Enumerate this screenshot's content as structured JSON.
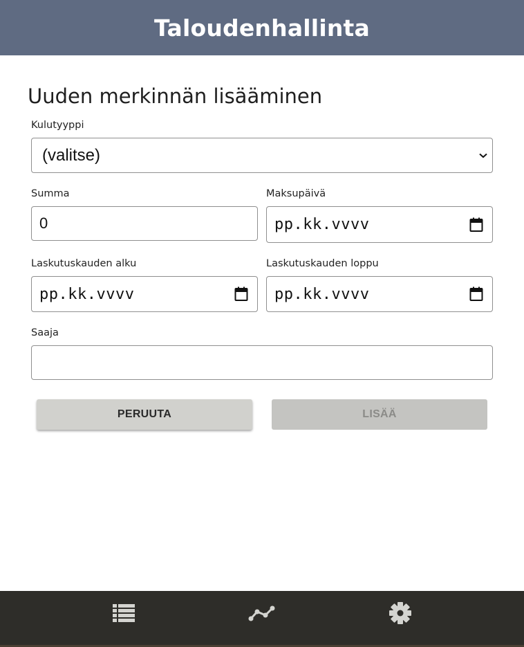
{
  "header": {
    "title": "Taloudenhallinta"
  },
  "form": {
    "title": "Uuden merkinnän lisääminen",
    "expense_type": {
      "label": "Kulutyyppi",
      "selected": "(valitse)"
    },
    "amount": {
      "label": "Summa",
      "value": "0"
    },
    "payment_date": {
      "label": "Maksupäivä",
      "placeholder": "pp.kk.vvvv"
    },
    "billing_start": {
      "label": "Laskutuskauden alku",
      "placeholder": "pp.kk.vvvv"
    },
    "billing_end": {
      "label": "Laskutuskauden loppu",
      "placeholder": "pp.kk.vvvv"
    },
    "recipient": {
      "label": "Saaja",
      "value": ""
    },
    "cancel_label": "PERUUTA",
    "add_label": "LISÄÄ",
    "add_enabled": false
  },
  "bottom_nav": {
    "items": [
      {
        "icon": "list-icon"
      },
      {
        "icon": "chart-icon"
      },
      {
        "icon": "gear-icon"
      }
    ]
  },
  "colors": {
    "header_bg": "#5f6b82",
    "nav_bg": "#2e2d29",
    "nav_icon": "#d4d4d0",
    "button_bg": "#d1d1cd",
    "button_disabled_bg": "#c4c4c1",
    "button_disabled_text": "#8b8b88"
  }
}
